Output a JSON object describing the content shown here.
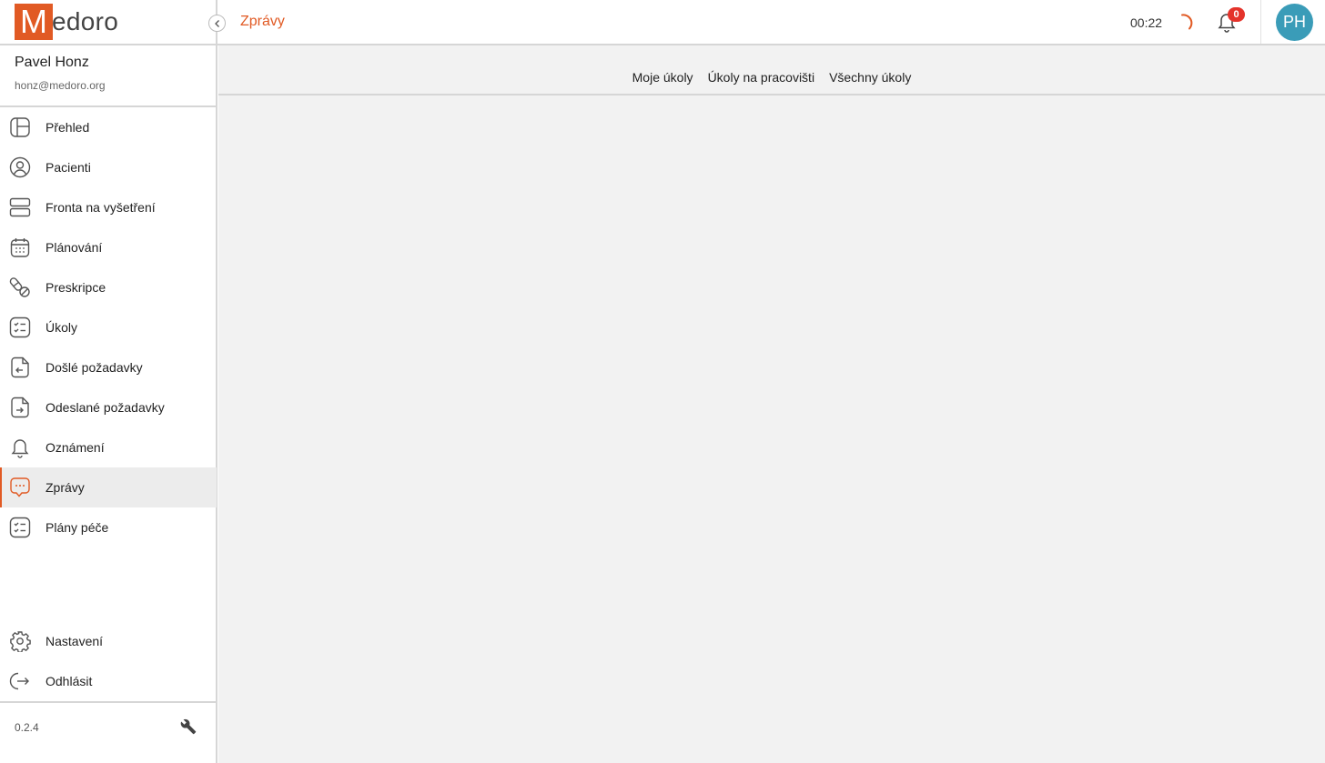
{
  "brand": {
    "logo_letter": "M",
    "logo_rest": "edoro",
    "accent_color": "#e15a24"
  },
  "user": {
    "name": "Pavel Honz",
    "email": "honz@medoro.org",
    "initials": "PH"
  },
  "header": {
    "title": "Zprávy",
    "timer": "00:22",
    "notification_count": "0"
  },
  "sidebar": {
    "items": [
      {
        "label": "Přehled",
        "icon": "dashboard-icon"
      },
      {
        "label": "Pacienti",
        "icon": "patient-icon"
      },
      {
        "label": "Fronta na vyšetření",
        "icon": "queue-icon"
      },
      {
        "label": "Plánování",
        "icon": "calendar-icon"
      },
      {
        "label": "Preskripce",
        "icon": "pills-icon"
      },
      {
        "label": "Úkoly",
        "icon": "checklist-icon"
      },
      {
        "label": "Došlé požadavky",
        "icon": "incoming-request-icon"
      },
      {
        "label": "Odeslané požadavky",
        "icon": "outgoing-request-icon"
      },
      {
        "label": "Oznámení",
        "icon": "bell-icon"
      },
      {
        "label": "Zprávy",
        "icon": "message-icon",
        "active": true
      },
      {
        "label": "Plány péče",
        "icon": "checklist-icon"
      }
    ],
    "bottom": [
      {
        "label": "Nastavení",
        "icon": "gear-icon"
      },
      {
        "label": "Odhlásit",
        "icon": "logout-icon"
      }
    ],
    "version": "0.2.4"
  },
  "tabs": [
    "Moje úkoly",
    "Úkoly na pracovišti",
    "Všechny úkoly"
  ]
}
